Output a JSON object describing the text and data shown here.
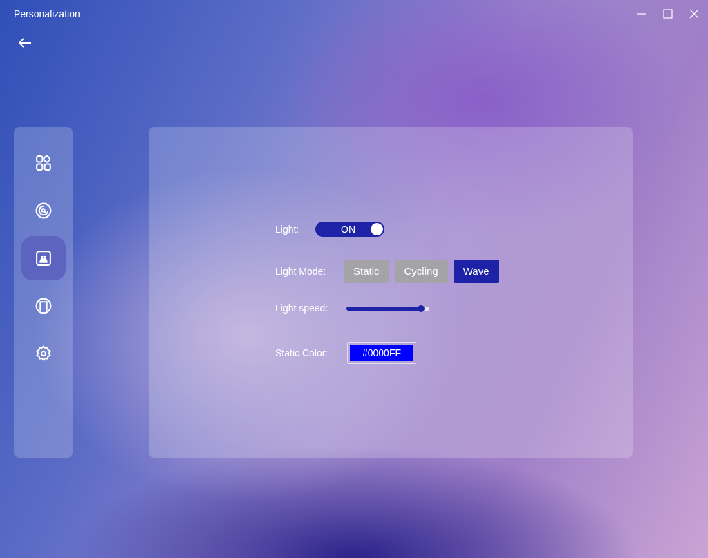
{
  "window": {
    "title": "Personalization"
  },
  "sidebar": {
    "items": [
      {
        "selected": false
      },
      {
        "selected": false
      },
      {
        "selected": true
      },
      {
        "selected": false
      },
      {
        "selected": false
      }
    ]
  },
  "settings": {
    "light": {
      "label": "Light:",
      "on": true,
      "state_text": "ON"
    },
    "light_mode": {
      "label": "Light Mode:",
      "options": [
        {
          "label": "Static",
          "selected": false
        },
        {
          "label": "Cycling",
          "selected": false
        },
        {
          "label": "Wave",
          "selected": true
        }
      ]
    },
    "light_speed": {
      "label": "Light speed:",
      "level": 0.9
    },
    "static_color": {
      "label": "Static Color:",
      "value": "#0000FF"
    }
  }
}
